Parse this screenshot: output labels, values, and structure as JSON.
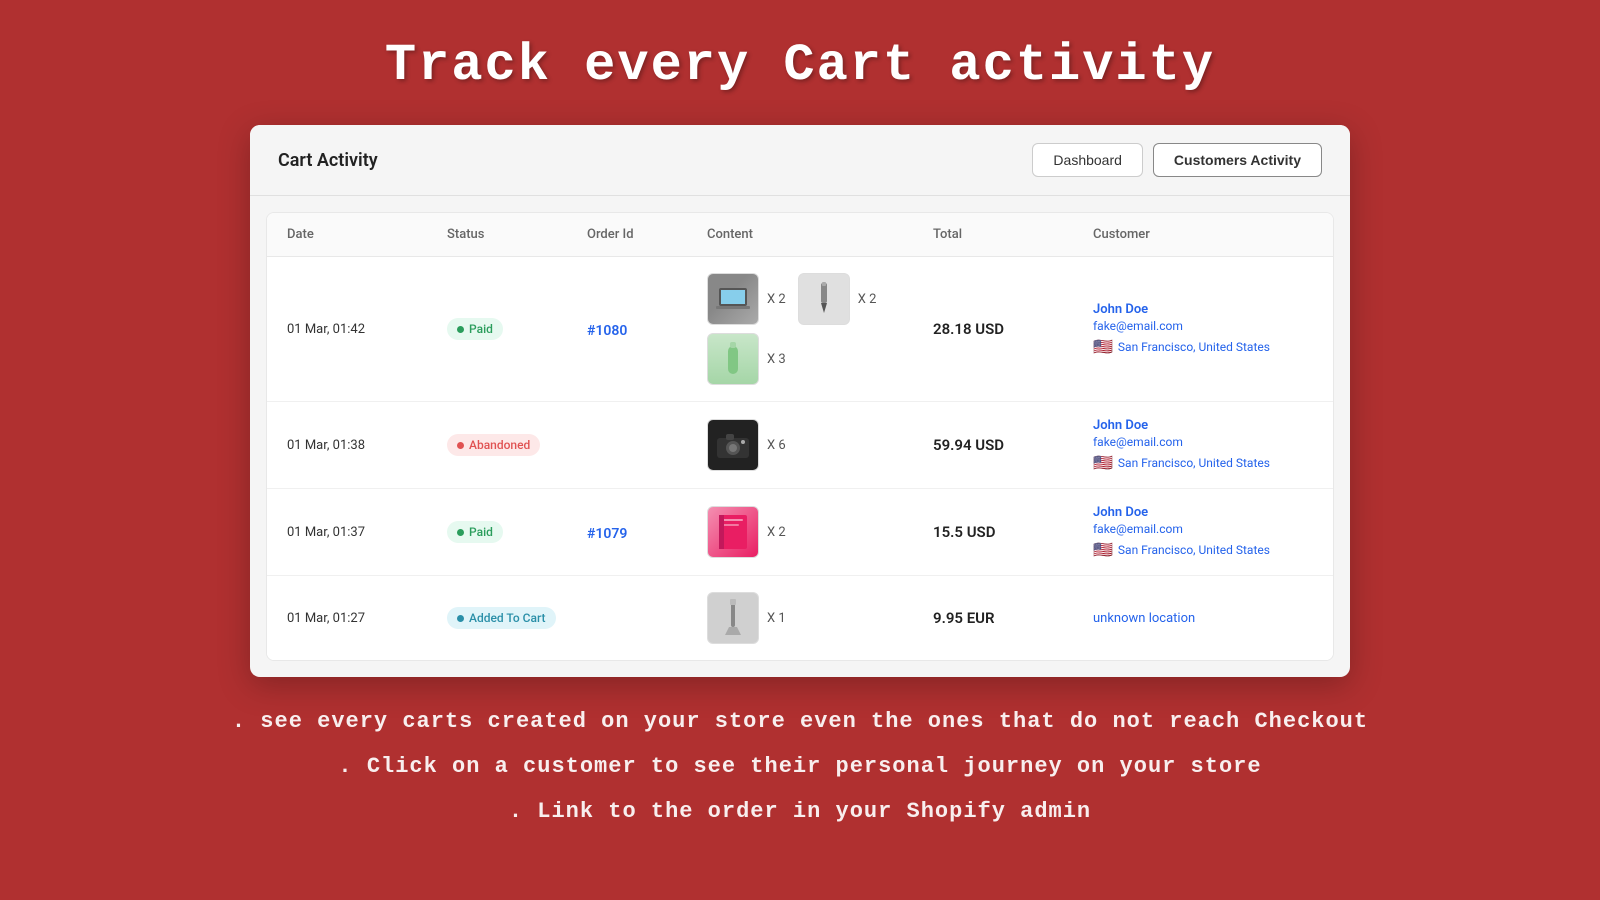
{
  "page": {
    "hero_title": "Track every Cart activity",
    "footer_lines": [
      ". see every carts created on your store even the ones that do not reach Checkout",
      ". Click on a customer to see their personal journey on your store",
      ". Link to the order in your Shopify admin"
    ]
  },
  "header": {
    "title": "Cart Activity",
    "buttons": [
      {
        "label": "Dashboard",
        "active": false
      },
      {
        "label": "Customers Activity",
        "active": true
      }
    ]
  },
  "table": {
    "columns": [
      "Date",
      "Status",
      "Order Id",
      "Content",
      "Total",
      "Customer"
    ],
    "rows": [
      {
        "date": "01 Mar, 01:42",
        "status": "Paid",
        "status_type": "paid",
        "order_id": "#1080",
        "order_link": "#1080",
        "products": [
          {
            "type": "laptop",
            "qty": "X 2"
          },
          {
            "type": "pen",
            "qty": "X 2"
          },
          {
            "type": "bottle",
            "qty": "X 3"
          }
        ],
        "total": "28.18 USD",
        "customer": {
          "name": "John Doe",
          "email": "fake@email.com",
          "location": "San Francisco, United States",
          "has_flag": true,
          "unknown": false
        }
      },
      {
        "date": "01 Mar, 01:38",
        "status": "Abandoned",
        "status_type": "abandoned",
        "order_id": "",
        "order_link": "",
        "products": [
          {
            "type": "camera",
            "qty": "X 6"
          }
        ],
        "total": "59.94 USD",
        "customer": {
          "name": "John Doe",
          "email": "fake@email.com",
          "location": "San Francisco, United States",
          "has_flag": true,
          "unknown": false
        }
      },
      {
        "date": "01 Mar, 01:37",
        "status": "Paid",
        "status_type": "paid",
        "order_id": "#1079",
        "order_link": "#1079",
        "products": [
          {
            "type": "book",
            "qty": "X 2"
          }
        ],
        "total": "15.5 USD",
        "customer": {
          "name": "John Doe",
          "email": "fake@email.com",
          "location": "San Francisco, United States",
          "has_flag": true,
          "unknown": false
        }
      },
      {
        "date": "01 Mar, 01:27",
        "status": "Added To Cart",
        "status_type": "cart",
        "order_id": "",
        "order_link": "",
        "products": [
          {
            "type": "screwdriver",
            "qty": "X 1"
          }
        ],
        "total": "9.95 EUR",
        "customer": {
          "name": "",
          "email": "",
          "location": "unknown location",
          "has_flag": false,
          "unknown": true
        }
      }
    ]
  }
}
